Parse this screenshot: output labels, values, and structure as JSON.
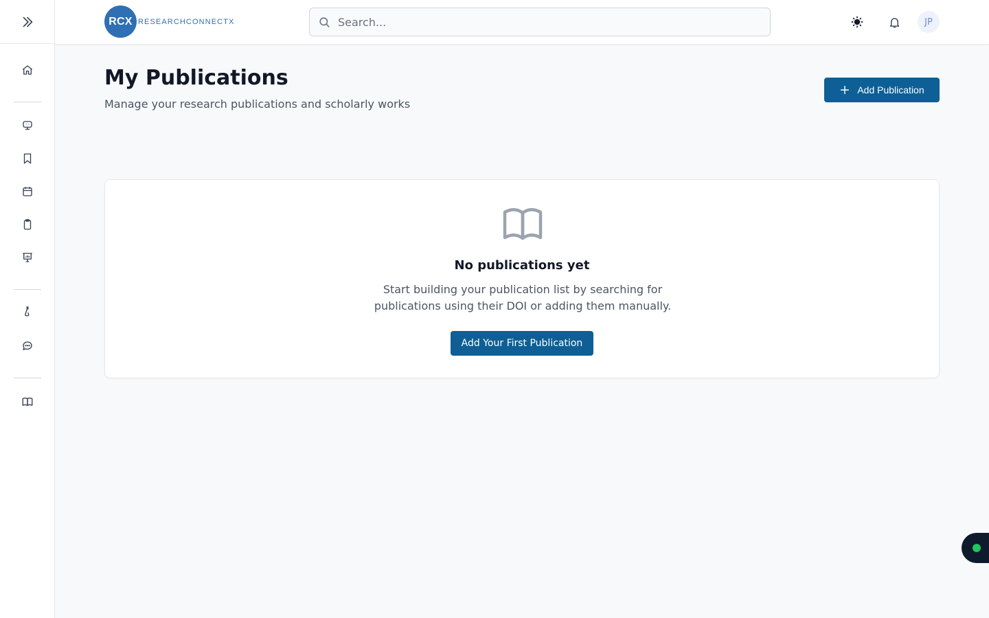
{
  "header": {
    "logo_mark": "RCX",
    "logo_text": "RESEARCHCONNECTX",
    "search_placeholder": "Search...",
    "avatar_initials": "JP"
  },
  "page": {
    "title": "My Publications",
    "subtitle": "Manage your research publications and scholarly works",
    "add_button_label": "Add Publication"
  },
  "empty_state": {
    "icon": "book-open-icon",
    "title": "No publications yet",
    "text": "Start building your publication list by searching for publications using their DOI or adding them manually.",
    "button_label": "Add Your First Publication"
  },
  "sidebar": {
    "icons": [
      "chevrons-right-icon",
      "home-icon",
      "monitor-icon",
      "bookmark-icon",
      "calendar-icon",
      "clipboard-icon",
      "presentation-icon",
      "flask-icon",
      "chat-icon",
      "book-icon"
    ]
  },
  "colors": {
    "primary": "#0e5f96",
    "logo": "#2f6fb3",
    "status": "#22c55e"
  }
}
